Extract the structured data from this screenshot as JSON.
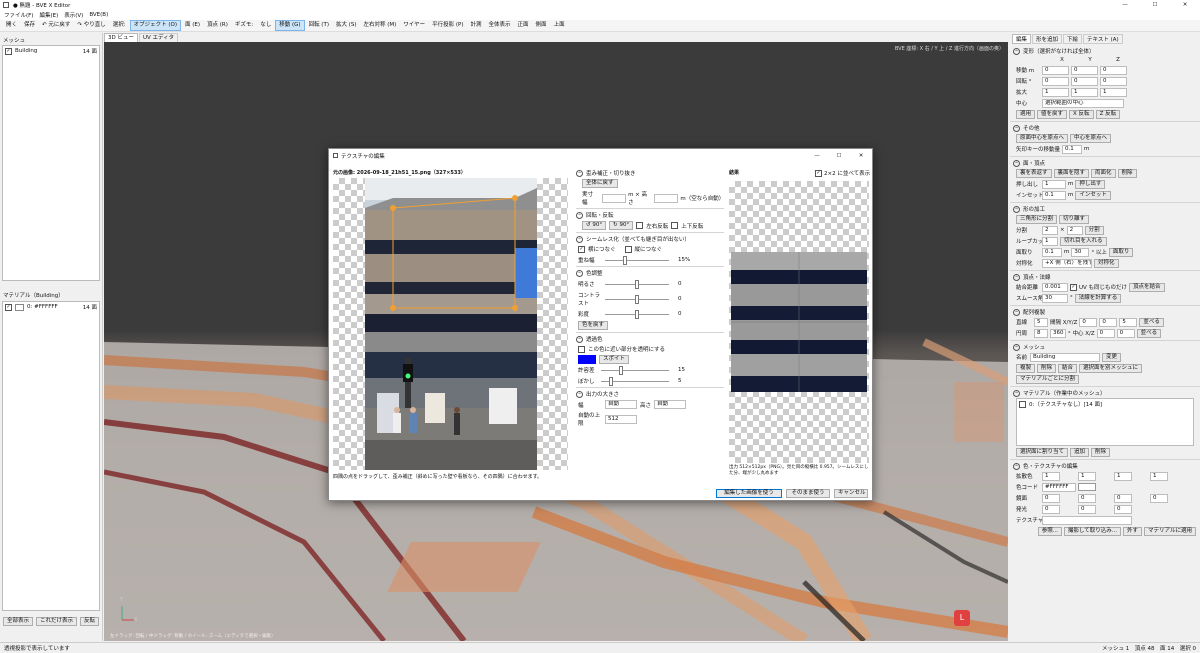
{
  "window": {
    "title": "● 無題 - BVE X Editor",
    "controls": {
      "minimize": "—",
      "maximize": "☐",
      "close": "✕"
    }
  },
  "menu": [
    "ファイル(F)",
    "編集(E)",
    "表示(V)",
    "BVE(B)"
  ],
  "toolbar": {
    "left": [
      "開く",
      "保存",
      "↶ 元に戻す",
      "↷ やり直し",
      "選択:"
    ],
    "modes": [
      {
        "label": "オブジェクト (O)",
        "active": true
      },
      {
        "label": "面 (E)",
        "active": false
      },
      {
        "label": "頂点 (R)",
        "active": false
      },
      {
        "label": "ギズモ:",
        "active": false
      },
      {
        "label": "なし",
        "active": false
      },
      {
        "label": "移動 (G)",
        "active": true
      },
      {
        "label": "回転 (T)",
        "active": false
      },
      {
        "label": "拡大 (S)",
        "active": false
      },
      {
        "label": "左右対称 (M)",
        "active": false
      },
      {
        "label": "ワイヤー",
        "active": false
      },
      {
        "label": "平行投影 (P)",
        "active": false
      },
      {
        "label": "計測",
        "active": false
      },
      {
        "label": "全体表示",
        "active": false
      },
      {
        "label": "正面",
        "active": false
      },
      {
        "label": "側面",
        "active": false
      },
      {
        "label": "上面",
        "active": false
      }
    ]
  },
  "left_panel": {
    "mesh_title": "メッシュ",
    "meshes": [
      {
        "name": "Building",
        "count": "14 面",
        "checked": true
      }
    ],
    "material_title": "マテリアル（Building）",
    "materials": [
      {
        "name": "0: #FFFFFF",
        "count": "14 面",
        "checked": true
      }
    ],
    "buttons": [
      "全部表示",
      "これだけ表示",
      "反転"
    ]
  },
  "viewport": {
    "tabs": [
      "3D ビュー",
      "UV エディタ"
    ],
    "info": "BVE 座標: X 右 / Y 上 / Z 進行方向（画面の奥）",
    "hint": "左ドラッグ: 回転 / 中ドラッグ: 移動 / ホイール: ズーム（エディタで選択・編集）",
    "gizmo_badge": "L",
    "axis_y": "Y",
    "axis_x": "X"
  },
  "dialog": {
    "title": "テクスチャの編集",
    "source_label": "元の画像: 2026-09-18_21h51_15.png（327×533）",
    "crop_hint": "四隅の点をドラッグして、歪み補正（斜めに写った壁や看板なら、その四隅）に合わせます。",
    "result_label": "結果",
    "tile_preview": "2×2 に並べて表示",
    "result_info": "出力 512×512px（PNG）。見た目の縦横比 0.957。シームレスにした分、端が少し丸めます",
    "sections": {
      "crop": {
        "title": "歪み補正・切り抜き",
        "reset": "全体に戻す",
        "size_label": "実寸 幅",
        "height_label": "m × 高さ",
        "unit_hint": "m（空なら自動）"
      },
      "rotate": {
        "title": "回転・反転",
        "rot_left": "↺ 90°",
        "rot_right": "↻ 90°",
        "flip_h": "左右反転",
        "flip_v": "上下反転"
      },
      "seamless": {
        "title": "シームレス化（並べても継ぎ目が出ない）",
        "horizontal": "横につなぐ",
        "vertical": "縦につなぐ",
        "overlap_label": "重ね幅",
        "overlap_value": "15%"
      },
      "color": {
        "title": "色調整",
        "brightness": "明るさ",
        "contrast": "コントラスト",
        "saturation": "彩度",
        "b_val": "0",
        "c_val": "0",
        "s_val": "0",
        "reset": "色を戻す"
      },
      "transparent": {
        "title": "透過色",
        "enable": "この色に近い部分を透明にする",
        "eyedropper": "スポイト",
        "tolerance": "許容差",
        "tol_val": "15",
        "blur": "ぼかし",
        "blur_val": "5"
      },
      "output": {
        "title": "出力の大きさ",
        "width": "幅",
        "width_val": "自動",
        "height": "高さ",
        "height_val": "自動",
        "max_label": "自動の上限",
        "max_val": "512"
      }
    },
    "buttons": {
      "use_edited": "編集した画像を使う",
      "use_original": "そのまま使う",
      "cancel": "キャンセル"
    },
    "colors": {
      "key": "#0000ff",
      "accent": "#f0a030"
    }
  },
  "right_panel": {
    "tabs": [
      "編集",
      "形を追加",
      "下絵",
      "テキスト (A)"
    ],
    "transform": {
      "title": "変形（選択がなければ全体）",
      "axes": [
        "X",
        "Y",
        "Z"
      ],
      "rows": [
        {
          "label": "移動 m",
          "values": [
            "0",
            "0",
            "0"
          ]
        },
        {
          "label": "回転 °",
          "values": [
            "0",
            "0",
            "0"
          ]
        },
        {
          "label": "拡大",
          "values": [
            "1",
            "1",
            "1"
          ]
        }
      ],
      "center_label": "中心",
      "center_value": "選択範囲の中心",
      "buttons": [
        "適用",
        "値を戻す",
        "X 反転",
        "Z 反転"
      ]
    },
    "misc": {
      "title": "その他",
      "buttons": [
        "原面中心を原点へ",
        "中心を原点へ"
      ],
      "step_label": "矢印キーの移動量",
      "step_value": "0.1",
      "step_unit": "m"
    },
    "face": {
      "title": "面・頂点",
      "buttons": [
        "裏を表返す",
        "裏面を隠す",
        "両面化",
        "削除"
      ],
      "push_label": "押し出し",
      "push_value": "1",
      "push_btn": "押し出す",
      "inset_label": "インセット",
      "inset_value": "0.1",
      "inset_btn": "インセット"
    },
    "shape": {
      "title": "形の加工",
      "buttons": [
        "三角形に分割",
        "切り離す"
      ],
      "split_label": "分割",
      "split_a": "2",
      "split_x": "×",
      "split_b": "2",
      "split_btn": "分割",
      "loop_label": "ループカット",
      "loop_value": "1",
      "loop_btn": "切れ目を入れる",
      "bevel_label": "面取り",
      "bevel_a": "0.1",
      "bevel_b": "30",
      "bevel_unit": "° 以上",
      "bevel_btn": "面取り",
      "sym_label": "対称化",
      "sym_value": "+X 側（右）を残す",
      "sym_btn": "対称化"
    },
    "vertex_merge": {
      "title": "頂点・法線",
      "merge_label": "結合距離",
      "merge_value": "0.001",
      "uv_same": "UV も同じものだけ",
      "merge_btn": "頂点を結合",
      "smooth_label": "スムース角",
      "smooth_value": "30",
      "smooth_btn": "法線を計算する"
    },
    "array": {
      "title": "配列複製",
      "linear_label": "直線",
      "linear_count": "5",
      "linear_axis": "間隔 X/Y/Z",
      "linear_vals": [
        "0",
        "0",
        "5"
      ],
      "linear_btn": "並べる",
      "circ_label": "円周",
      "circ_count": "8",
      "circ_angle": "360",
      "circ_axis": "° 中心 X/Z",
      "circ_vals": [
        "0",
        "0"
      ],
      "circ_btn": "並べる"
    },
    "mesh": {
      "title": "メッシュ",
      "name_label": "名前",
      "name_value": "Building",
      "rename_btn": "変更",
      "buttons": [
        "複製",
        "削除",
        "結合",
        "選択面を別メッシュに"
      ],
      "split_btn": "マテリアルごとに分割"
    },
    "material": {
      "title": "マテリアル（作業中のメッシュ）",
      "items": [
        "0:（テクスチャなし）[14 面]"
      ],
      "buttons": [
        "選択面に割り当て",
        "追加",
        "削除"
      ]
    },
    "color_tex": {
      "title": "色・テクスチャの編集",
      "diffuse_label": "拡散色",
      "diffuse": [
        "1",
        "1",
        "1",
        "1"
      ],
      "code_label": "色コード",
      "code_value": "#FFFFFF",
      "spec_label": "鏡面",
      "spec": [
        "0",
        "0",
        "0",
        "0"
      ],
      "emit_label": "発光",
      "emit": [
        "0",
        "0",
        "0"
      ],
      "tex_label": "テクスチャ",
      "buttons": [
        "参照...",
        "撮影して取り込み...",
        "外す",
        "マテリアルに適用"
      ]
    }
  },
  "status": {
    "left": "透視投影で表示しています",
    "right": "メッシュ 1　頂点 48　面 14　選択 0"
  }
}
